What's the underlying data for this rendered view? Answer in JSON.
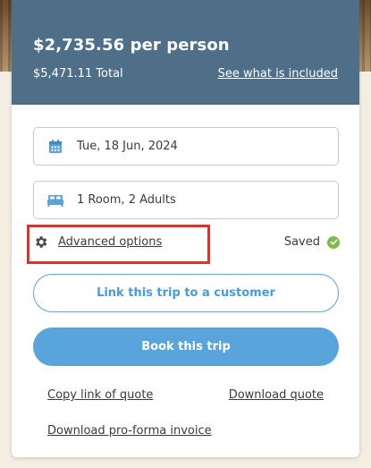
{
  "header": {
    "price_per_person": "$2,735.56 per person",
    "total": "$5,471.11 Total",
    "included_link": "See what is included"
  },
  "fields": {
    "date": {
      "value": "Tue, 18 Jun, 2024",
      "icon": "calendar-icon"
    },
    "rooms": {
      "value": "1 Room, 2 Adults",
      "icon": "bed-icon"
    }
  },
  "advanced": {
    "label": "Advanced options",
    "icon": "gear-icon"
  },
  "status": {
    "label": "Saved",
    "icon": "check-circle-icon",
    "color": "#7dbb4a"
  },
  "buttons": {
    "link_customer": "Link this trip to a customer",
    "book": "Book this trip"
  },
  "links": {
    "copy_quote": "Copy link of quote",
    "download_quote": "Download quote",
    "download_proforma": "Download pro-forma invoice"
  },
  "colors": {
    "header_bg": "#4f6f88",
    "accent": "#5aa4dc",
    "highlight": "#e0302a"
  }
}
